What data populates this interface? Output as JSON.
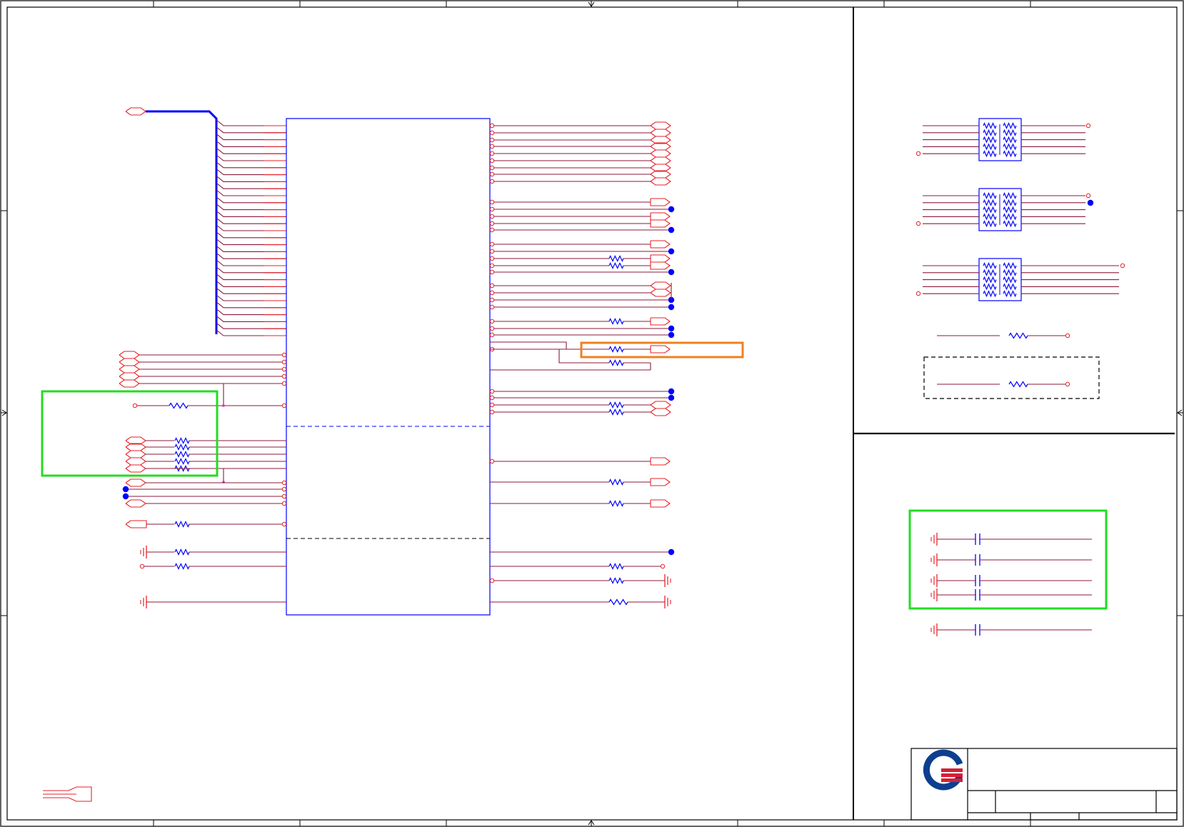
{
  "sheet": {
    "title": "",
    "logo": "qisda-logo"
  },
  "colors": {
    "wire": "#8b1a3a",
    "pin": "#e8222a",
    "component": "#0000ff",
    "highlight_green": "#22dd22",
    "highlight_orange": "#f08020",
    "border": "#000000",
    "logo_blue": "#0d3f8f",
    "logo_red": "#d42038"
  },
  "icons": {
    "ground": "ground-symbol-icon",
    "offpage_connector": "offpage-connector-icon",
    "junction": "junction-dot-icon",
    "resistor": "resistor-icon",
    "capacitor": "capacitor-icon",
    "resistor_network": "resistor-network-icon"
  }
}
